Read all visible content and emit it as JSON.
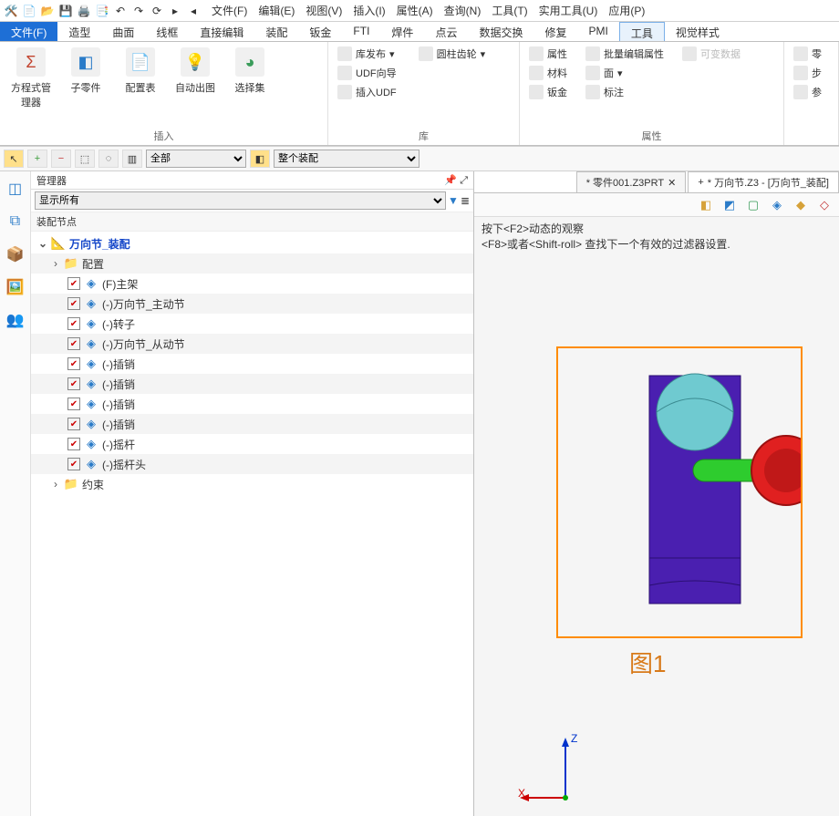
{
  "menubar": [
    "文件(F)",
    "编辑(E)",
    "视图(V)",
    "插入(I)",
    "属性(A)",
    "查询(N)",
    "工具(T)",
    "实用工具(U)",
    "应用(P)"
  ],
  "ribbon_tabs": [
    "文件(F)",
    "造型",
    "曲面",
    "线框",
    "直接编辑",
    "装配",
    "钣金",
    "FTI",
    "焊件",
    "点云",
    "数据交换",
    "修复",
    "PMI",
    "工具",
    "视觉样式"
  ],
  "active_tab": "文件(F)",
  "highlight_tab": "工具",
  "group_insert": {
    "eq": "方程式管理器",
    "sub": "子零件",
    "cfg": "配置表",
    "auto": "自动出图",
    "sel": "选择集",
    "label": "插入"
  },
  "group_lib": {
    "pub": "库发布",
    "udf": "UDF向导",
    "ins": "插入UDF",
    "gear": "圆柱齿轮",
    "label": "库"
  },
  "group_attr": {
    "attr": "属性",
    "mat": "材料",
    "sm": "钣金",
    "batch": "批量编辑属性",
    "face": "面",
    "anno": "标注",
    "var": "可变数据",
    "label": "属性"
  },
  "group_misc": {
    "s1": "零",
    "s2": "步",
    "s3": "参"
  },
  "toolbar2": {
    "combo1": "全部",
    "combo2": "整个装配"
  },
  "manager": {
    "title": "管理器",
    "filter": "显示所有",
    "sub": "装配节点",
    "root": "万向节_装配",
    "cfg": "配置",
    "items": [
      "(F)主架",
      "(-)万向节_主动节",
      "(-)转子",
      "(-)万向节_从动节",
      "(-)插销",
      "(-)插销",
      "(-)插销",
      "(-)插销",
      "(-)摇杆",
      "(-)摇杆头"
    ],
    "constraint": "约束"
  },
  "docs": {
    "tab1": "* 零件001.Z3PRT",
    "tab2": "* 万向节.Z3 - [万向节_装配]"
  },
  "hints": {
    "l1": "按下<F2>动态的观察",
    "l2": "<F8>或者<Shift-roll> 查找下一个有效的过滤器设置."
  },
  "fig_caption": "图1",
  "axis": {
    "z": "Z",
    "x": "X"
  }
}
